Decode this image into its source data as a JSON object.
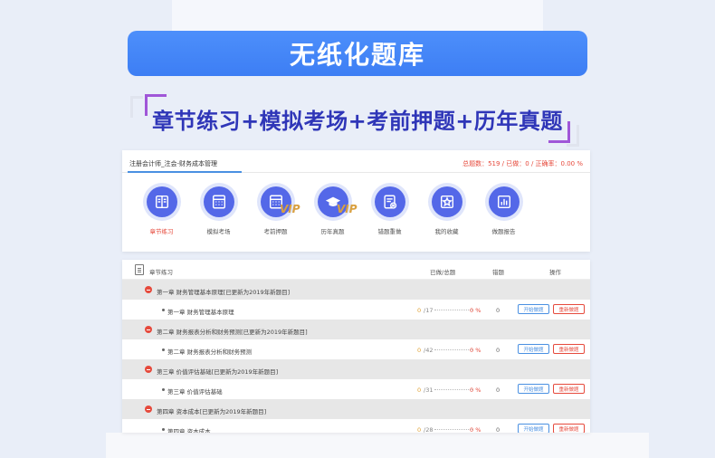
{
  "hero": {
    "title": "无纸化题库"
  },
  "subtitle": "章节练习+模拟考场+考前押题+历年真题",
  "course": {
    "title": "注册会计师_注会-财务成本管理",
    "stats": "总题数：519 / 已做：0 / 正确率：0.00 %"
  },
  "modules": [
    {
      "label": "章节练习",
      "icon": "book-icon",
      "vip": false,
      "active": true
    },
    {
      "label": "模拟考场",
      "icon": "calculator-icon",
      "vip": false,
      "active": false
    },
    {
      "label": "考前押题",
      "icon": "calculator-icon",
      "vip": true,
      "active": false
    },
    {
      "label": "历年真题",
      "icon": "graduation-cap-icon",
      "vip": true,
      "active": false
    },
    {
      "label": "错题重做",
      "icon": "error-doc-icon",
      "vip": false,
      "active": false
    },
    {
      "label": "我的收藏",
      "icon": "star-icon",
      "vip": false,
      "active": false
    },
    {
      "label": "做题报告",
      "icon": "bar-chart-icon",
      "vip": false,
      "active": false
    }
  ],
  "vip_text": "VIP",
  "list": {
    "headers": {
      "name": "章节练习",
      "done_total": "已做/总题",
      "wrong": "错题",
      "action": "操作"
    },
    "start_label": "开始做题",
    "redo_label": "重新做题",
    "chapters": [
      {
        "title": "第一章  财务管理基本原理[已更新为2019年新题目]",
        "section": "第一章  财务管理基本原理",
        "done": "0",
        "total": "/17",
        "pct": "0 %",
        "wrong": "0"
      },
      {
        "title": "第二章  财务报表分析和财务预测[已更新为2019年新题目]",
        "section": "第二章  财务报表分析和财务预测",
        "done": "0",
        "total": "/42",
        "pct": "0 %",
        "wrong": "0"
      },
      {
        "title": "第三章  价值评估基础[已更新为2019年新题目]",
        "section": "第三章  价值评估基础",
        "done": "0",
        "total": "/31",
        "pct": "0 %",
        "wrong": "0"
      },
      {
        "title": "第四章  资本成本[已更新为2019年新题目]",
        "section": "第四章  资本成本",
        "done": "0",
        "total": "/28",
        "pct": "0 %",
        "wrong": "0"
      }
    ]
  },
  "colors": {
    "accent": "#4a8af8",
    "subtitle": "#2f36b8",
    "icon_bg": "#5468e8",
    "alert": "#e64a3c"
  }
}
